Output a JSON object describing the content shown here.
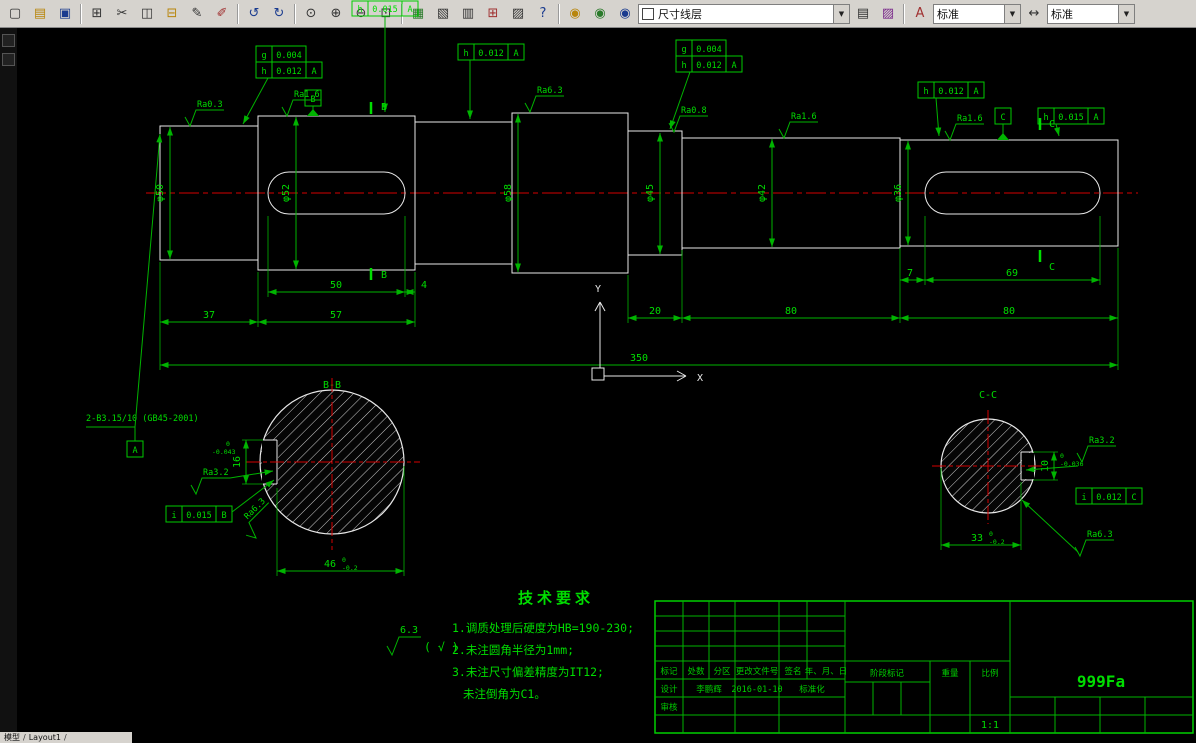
{
  "colors": {
    "dimension_green": "#00b400",
    "text_green": "#00dd00",
    "centerline_red": "#d40000",
    "outline_white": "#e8e8e8"
  },
  "toolbar": {
    "dropdown_arrow": "▼",
    "layer_combo": {
      "value": "尺寸线层"
    },
    "text_style_combo": {
      "value": "标准"
    },
    "dim_style_combo": {
      "value": "标准"
    },
    "buttons": [
      {
        "name": "new-file",
        "glyph": "▢"
      },
      {
        "name": "open-file",
        "glyph": "▤"
      },
      {
        "name": "save-file",
        "glyph": "▣"
      },
      {
        "name": "plot",
        "glyph": "⊞"
      },
      {
        "name": "cut",
        "glyph": "✂"
      },
      {
        "name": "copy",
        "glyph": "◫"
      },
      {
        "name": "paste",
        "glyph": "⊟"
      },
      {
        "name": "pencil",
        "glyph": "✎"
      },
      {
        "name": "brush",
        "glyph": "✐"
      },
      {
        "name": "undo",
        "glyph": "↺"
      },
      {
        "name": "redo",
        "glyph": "↻"
      },
      {
        "name": "zoom-previous",
        "glyph": "⊙"
      },
      {
        "name": "zoom-in",
        "glyph": "⊕"
      },
      {
        "name": "zoom-out",
        "glyph": "⊖"
      },
      {
        "name": "zoom-window",
        "glyph": "⊡"
      },
      {
        "name": "layer-manager",
        "glyph": "▦"
      },
      {
        "name": "frame",
        "glyph": "▧"
      },
      {
        "name": "title-block-tool",
        "glyph": "▥"
      },
      {
        "name": "bom-table",
        "glyph": "⊞"
      },
      {
        "name": "image",
        "glyph": "▨"
      },
      {
        "name": "help",
        "glyph": "?"
      },
      {
        "name": "layer-visibility",
        "glyph": "◉"
      },
      {
        "name": "layer-freeze",
        "glyph": "◉"
      },
      {
        "name": "layer-lock",
        "glyph": "◉"
      },
      {
        "name": "layer-list",
        "glyph": "▤"
      },
      {
        "name": "color-picker",
        "glyph": "▨"
      },
      {
        "name": "text-style",
        "glyph": "A"
      },
      {
        "name": "dim-style",
        "glyph": "↔"
      }
    ]
  },
  "statusbar": {
    "model_tab": "模型",
    "layout_tab": "Layout1",
    "separator": "/"
  },
  "drawing": {
    "note": "2-B3.15/10 (GB45-2001)",
    "datum": {
      "a": "A",
      "b": "B",
      "c": "C"
    },
    "section_marks": {
      "b": "B",
      "c": "C"
    },
    "axis": {
      "x": "X",
      "y": "Y"
    },
    "diameters": {
      "d1": "φ50",
      "d2": "φ52",
      "d3": "φ58",
      "d4": "φ45",
      "d5": "φ42",
      "d6": "φ36"
    },
    "lengths": {
      "l50": "50",
      "l4": "4",
      "l37": "37",
      "l57": "57",
      "l20": "20",
      "l80a": "80",
      "l80b": "80",
      "l350": "350",
      "l7": "7",
      "l69": "69"
    },
    "roughness": {
      "r1": "Ra0.3",
      "r2": "Ra1.6",
      "r3": "Ra6.3",
      "r4": "Ra0.8",
      "r5": "Ra1.6",
      "r6": "Ra1.6",
      "bb_key": "Ra3.2",
      "bb_hatch": "Ra6.3",
      "cc_key": "Ra3.2",
      "cc_hatch": "Ra6.3",
      "general": "6.3",
      "general_suffix": "( √ )"
    },
    "tol": {
      "t1": {
        "sym": "g",
        "val": "0.004"
      },
      "t2": {
        "sym": "h",
        "val": "0.012",
        "datum": "A"
      },
      "t3": {
        "sym": "h",
        "val": "0.015",
        "datum": "A"
      },
      "t4": {
        "sym": "h",
        "val": "0.012",
        "datum": "A"
      },
      "t5": {
        "sym": "g",
        "val": "0.004"
      },
      "t6": {
        "sym": "h",
        "val": "0.012",
        "datum": "A"
      },
      "t7": {
        "sym": "h",
        "val": "0.012",
        "datum": "A"
      },
      "t8": {
        "sym": "h",
        "val": "0.015",
        "datum": "A"
      },
      "t9": {
        "sym": "i",
        "val": "0.015",
        "datum": "B"
      },
      "t10": {
        "sym": "i",
        "val": "0.012",
        "datum": "C"
      }
    },
    "sections": {
      "bb": {
        "title": "B-B",
        "width": "46",
        "width_tol_up": "0",
        "width_tol_dn": "-0.2",
        "depth": "16",
        "depth_tol_up": "0",
        "depth_tol_dn": "-0.043"
      },
      "cc": {
        "title": "C-C",
        "width": "33",
        "width_tol_up": "0",
        "width_tol_dn": "-0.2",
        "depth": "10",
        "depth_tol_up": "0",
        "depth_tol_dn": "-0.036"
      }
    },
    "tech": {
      "title": "技术要求",
      "item1": "1.调质处理后硬度为HB=190-230;",
      "item2": "2.未注圆角半径为1mm;",
      "item3": "3.未注尺寸偏差精度为IT12;",
      "item4": "未注倒角为C1。"
    }
  },
  "title_block": {
    "h1": "标记",
    "h2": "处数",
    "h3": "分区",
    "h4": "更改文件号",
    "h5": "签名",
    "h6": "年、月、日",
    "design": "设计",
    "designer": "李鹏辉",
    "date": "2016-01-10",
    "standardize": "标准化",
    "check": "审核",
    "stage": "阶段标记",
    "weight": "重量",
    "scale": "比例",
    "scale_value": "1:1",
    "drawing_no": "999Fa"
  }
}
